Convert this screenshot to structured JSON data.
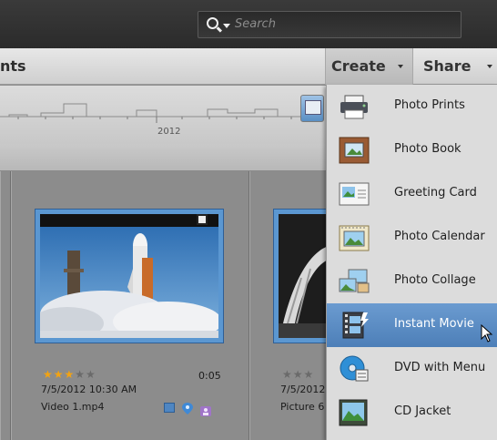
{
  "search": {
    "placeholder": "Search"
  },
  "toolbar": {
    "title_fragment": "nts",
    "create_label": "Create",
    "share_label": "Share"
  },
  "timeline": {
    "year_label": "2012"
  },
  "grid": {
    "items": [
      {
        "rating": 3,
        "rating_max": 5,
        "duration": "0:05",
        "datetime": "7/5/2012 10:30 AM",
        "filename": "Video 1.mp4"
      },
      {
        "rating": 0,
        "rating_max": 5,
        "datetime": "7/5/2012",
        "filename": "Picture 6"
      }
    ]
  },
  "create_menu": {
    "items": [
      {
        "label": "Photo Prints",
        "icon": "printer-icon"
      },
      {
        "label": "Photo Book",
        "icon": "photo-book-icon"
      },
      {
        "label": "Greeting Card",
        "icon": "greeting-card-icon"
      },
      {
        "label": "Photo Calendar",
        "icon": "calendar-icon"
      },
      {
        "label": "Photo Collage",
        "icon": "collage-icon"
      },
      {
        "label": "Instant Movie",
        "icon": "movie-icon",
        "highlighted": true
      },
      {
        "label": "DVD with Menu",
        "icon": "dvd-icon"
      },
      {
        "label": "CD Jacket",
        "icon": "cd-jacket-icon"
      }
    ]
  },
  "colors": {
    "menu_highlight": "#5a8cc6",
    "thumbnail_border": "#5b97d1",
    "star_on": "#f2a312"
  }
}
